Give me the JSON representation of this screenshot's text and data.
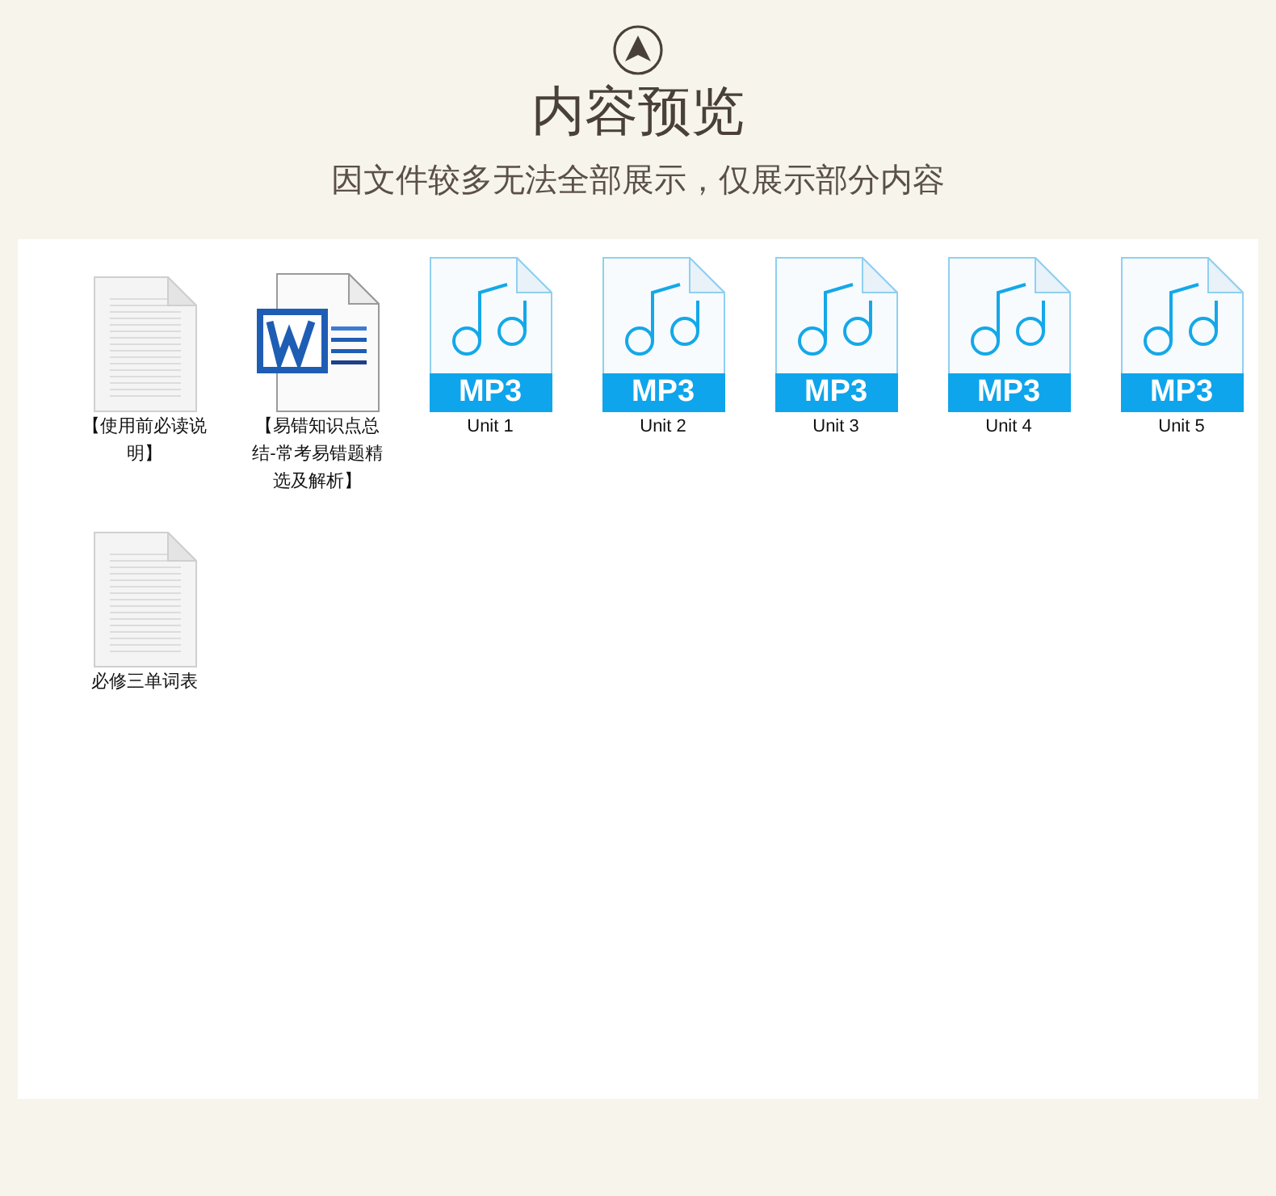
{
  "header": {
    "title": "内容预览",
    "subtitle": "因文件较多无法全部展示，仅展示部分内容"
  },
  "files": [
    {
      "kind": "text",
      "name": "【使用前必读说明】"
    },
    {
      "kind": "word",
      "name": "【易错知识点总结-常考易错题精选及解析】"
    },
    {
      "kind": "mp3",
      "badge": "MP3",
      "name": "Unit 1"
    },
    {
      "kind": "mp3",
      "badge": "MP3",
      "name": "Unit 2"
    },
    {
      "kind": "mp3",
      "badge": "MP3",
      "name": "Unit 3"
    },
    {
      "kind": "mp3",
      "badge": "MP3",
      "name": "Unit 4"
    },
    {
      "kind": "mp3",
      "badge": "MP3",
      "name": "Unit 5"
    },
    {
      "kind": "text",
      "name": "必修三单词表"
    }
  ]
}
